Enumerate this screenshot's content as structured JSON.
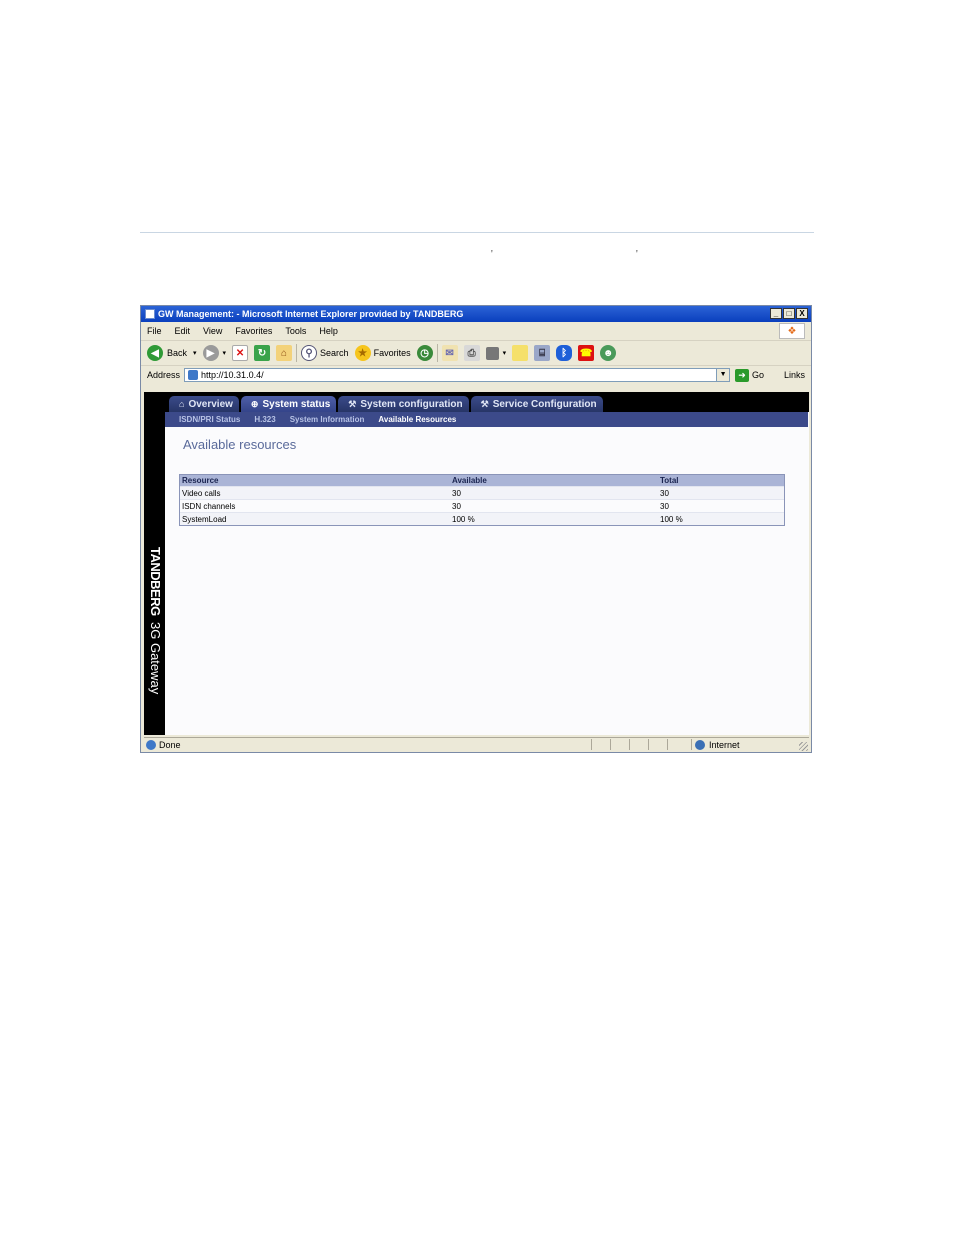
{
  "document": {
    "tick_left": "'",
    "tick_right": "'"
  },
  "window": {
    "title": "GW Management: - Microsoft Internet Explorer provided by TANDBERG",
    "min_glyph": "_",
    "max_glyph": "□",
    "close_glyph": "X"
  },
  "menu": {
    "items": [
      "File",
      "Edit",
      "View",
      "Favorites",
      "Tools",
      "Help"
    ]
  },
  "toolbar": {
    "back_label": "Back",
    "search_label": "Search",
    "favorites_label": "Favorites"
  },
  "address": {
    "label": "Address",
    "url": "http://10.31.0.4/",
    "go_label": "Go",
    "links_label": "Links"
  },
  "app": {
    "brand_bold": "TANDBERG",
    "brand_rest": "3G Gateway",
    "tabs": [
      {
        "label": "Overview",
        "icon": "⌂"
      },
      {
        "label": "System status",
        "icon": "⊕"
      },
      {
        "label": "System configuration",
        "icon": "⚒"
      },
      {
        "label": "Service Configuration",
        "icon": "⚒"
      }
    ],
    "active_tab_index": 1,
    "subnav": [
      "ISDN/PRI Status",
      "H.323",
      "System Information",
      "Available Resources"
    ],
    "active_subnav_index": 3,
    "page_title": "Available resources",
    "table": {
      "headers": [
        "Resource",
        "Available",
        "Total"
      ],
      "rows": [
        [
          "Video calls",
          "30",
          "30"
        ],
        [
          "ISDN channels",
          "30",
          "30"
        ],
        [
          "SystemLoad",
          "100 %",
          "100 %"
        ]
      ]
    }
  },
  "status": {
    "text": "Done",
    "zone": "Internet"
  },
  "colors": {
    "titlebar": "#0a3fbd",
    "tab_bg": "#273567",
    "subnav_bg": "#3c4a8a",
    "table_header": "#aab4d6",
    "page_title": "#5a6a9a"
  }
}
